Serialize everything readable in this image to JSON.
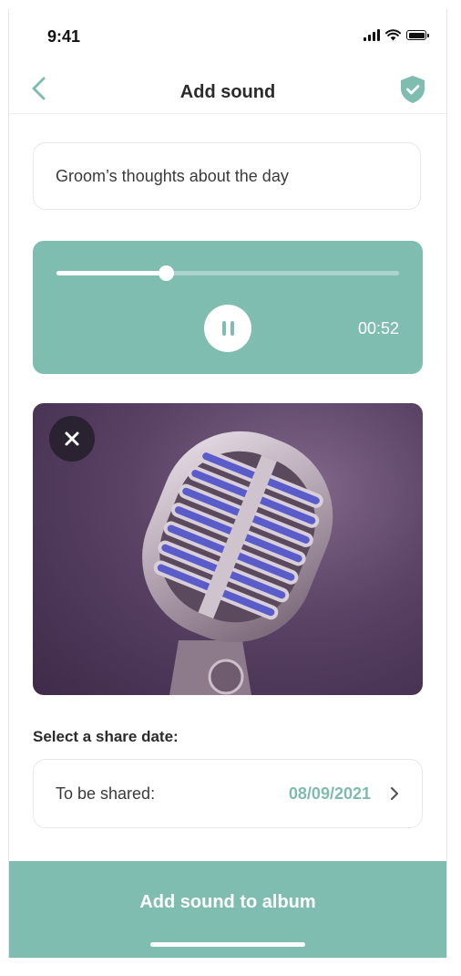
{
  "status_bar": {
    "time": "9:41"
  },
  "nav": {
    "title": "Add sound",
    "back_icon": "chevron-left-icon",
    "shield_icon": "shield-check-icon"
  },
  "sound_title": {
    "value": "Groom’s thoughts about the day"
  },
  "player": {
    "progress": 0.32,
    "elapsed": "00:52",
    "state_icon": "pause-icon"
  },
  "image": {
    "subject": "microphone-photo",
    "remove_icon": "close-icon"
  },
  "share": {
    "section_label": "Select a share date:",
    "row_label": "To be shared:",
    "date": "08/09/2021"
  },
  "cta": {
    "label": "Add sound to album"
  },
  "colors": {
    "accent": "#80bdb1",
    "accent_text": "#7fbbb0",
    "image_bg": "#5a4265"
  }
}
